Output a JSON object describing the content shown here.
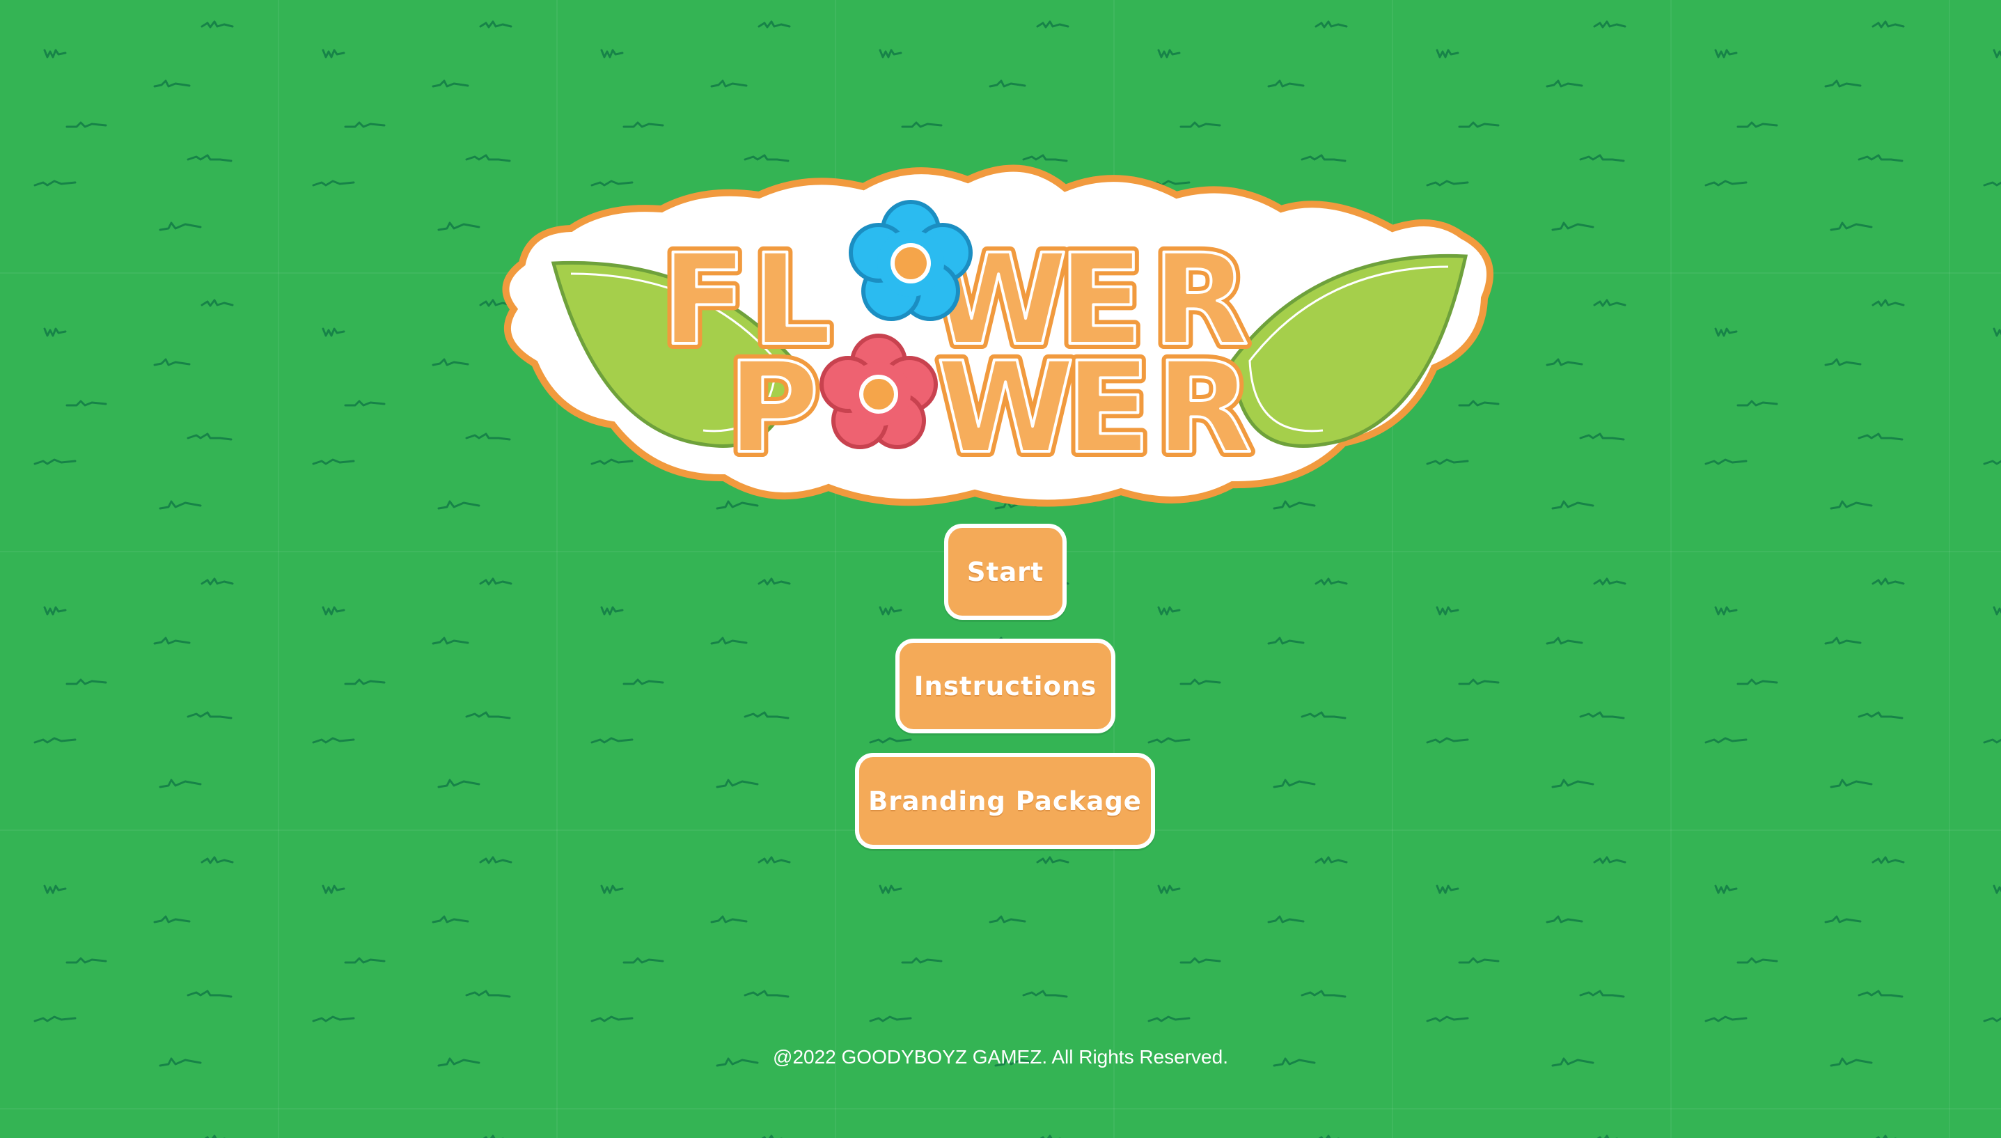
{
  "game": {
    "title_line1": "FLOWER",
    "title_line2": "POWER"
  },
  "menu": {
    "start_label": "Start",
    "instructions_label": "Instructions",
    "branding_label": "Branding Package"
  },
  "footer": {
    "copyright": "@2022 GOODYBOYZ GAMEZ. All Rights Reserved."
  },
  "colors": {
    "background": "#34b454",
    "grass_mark": "#178348",
    "button_fill": "#f4aa58",
    "button_border": "#ffffff",
    "logo_orange": "#f4aa58",
    "logo_outline": "#f19a3e",
    "leaf_green": "#a5cf4b",
    "flower_blue": "#2bbbf0",
    "flower_pink": "#ee6271",
    "flower_center": "#f5a54a"
  },
  "icons": [
    "blue-flower-icon",
    "pink-flower-icon",
    "leaf-left-icon",
    "leaf-right-icon"
  ]
}
